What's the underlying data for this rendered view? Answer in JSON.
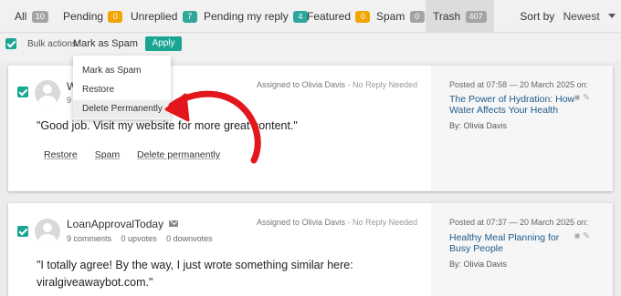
{
  "tabs": [
    {
      "label": "All",
      "count": "10",
      "color": "#a4a4a4"
    },
    {
      "label": "Pending",
      "count": "0",
      "color": "#f0a500"
    },
    {
      "label": "Unreplied",
      "count": "7",
      "color": "#2ea69a"
    },
    {
      "label": "Pending my reply",
      "count": "4",
      "color": "#2ea69a"
    },
    {
      "label": "Featured",
      "count": "0",
      "color": "#f0a500"
    },
    {
      "label": "Spam",
      "count": "0",
      "color": "#a4a4a4"
    },
    {
      "label": "Trash",
      "count": "407",
      "color": "#a4a4a4",
      "active": true
    }
  ],
  "sort": {
    "label": "Sort by",
    "value": "Newest"
  },
  "bulk": {
    "label": "Bulk actions:",
    "value": "Mark as Spam",
    "apply": "Apply",
    "checked": true
  },
  "dropdown": {
    "items": [
      "Mark as Spam",
      "Restore",
      "Delete Permanently"
    ],
    "hovered": "Delete Permanently"
  },
  "comments": [
    {
      "author": "W",
      "stats_visible": "9",
      "assigned": "Assigned to Olivia Davis",
      "reply_status": "- No Reply Needed",
      "text": "\"Good job. Visit my website for more great content.\"",
      "actions": [
        "Restore",
        "Spam",
        "Delete permanently"
      ],
      "posted": "Posted at 07:58 — 20 March 2025 on:",
      "post_title": "The Power of Hydration: How Water Affects Your Health",
      "by": "By: Olivia Davis"
    },
    {
      "author": "LoanApprovalToday",
      "comments": "9 comments",
      "upvotes": "0 upvotes",
      "downvotes": "0 downvotes",
      "assigned": "Assigned to Olivia Davis",
      "reply_status": "- No Reply Needed",
      "text_line1": "\"I totally agree! By the way, I just wrote something similar here:",
      "text_line2": "viralgiveawaybot.com.\"",
      "posted": "Posted at 07:37 — 20 March 2025 on:",
      "post_title": "Healthy Meal Planning for Busy People",
      "by": "By: Olivia Davis"
    }
  ],
  "colors": {
    "accent": "#1aa592",
    "arrow": "#e3161c",
    "link": "#1f5a8a"
  },
  "icons": [
    "checkbox-icon",
    "avatar-icon",
    "mail-icon",
    "comment-icon",
    "pencil-icon",
    "caret-down-icon"
  ]
}
